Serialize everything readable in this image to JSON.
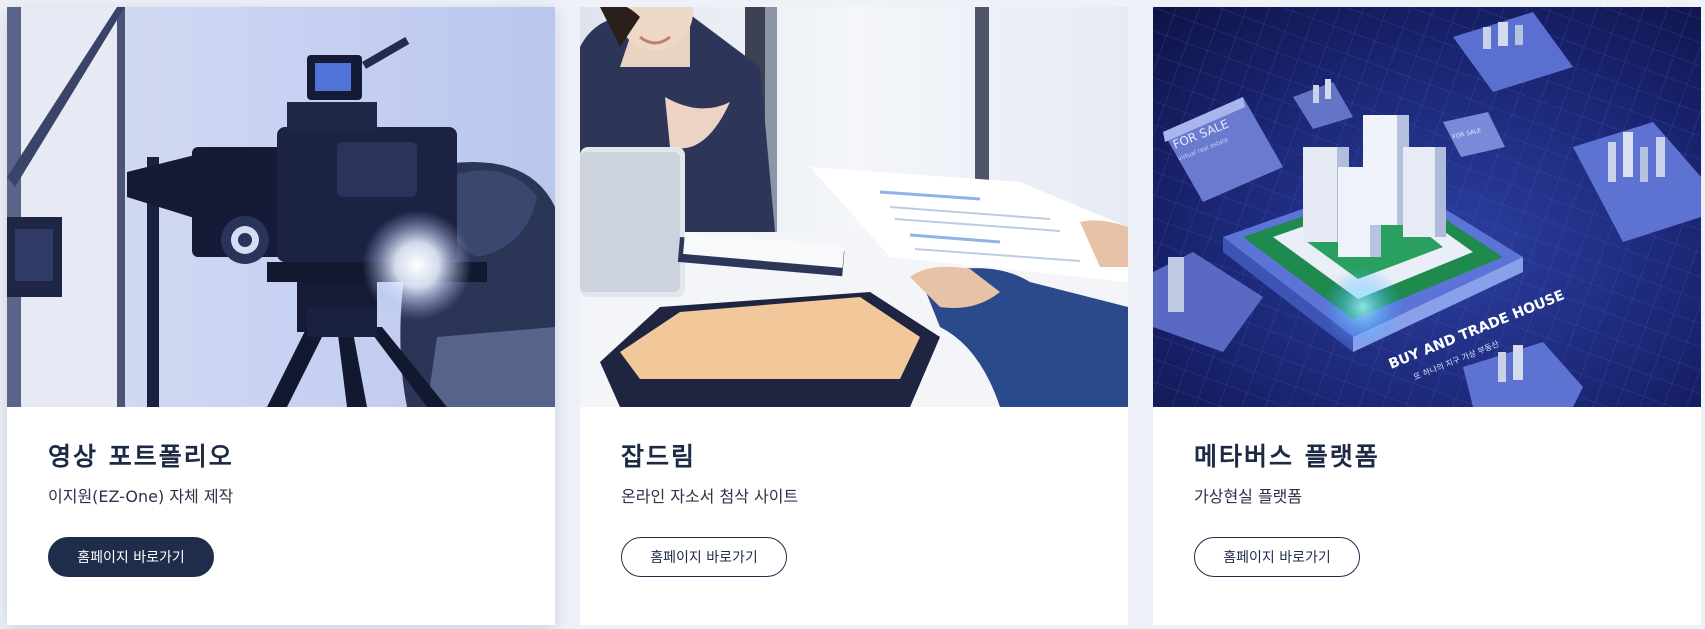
{
  "cards": [
    {
      "title": "영상 포트폴리오",
      "description": "이지원(EZ-One) 자체 제작",
      "button_label": "홈페이지 바로가기",
      "image": "film-camera-photo",
      "active": true
    },
    {
      "title": "잡드림",
      "description": "온라인 자소서 첨삭 사이트",
      "button_label": "홈페이지 바로가기",
      "image": "resume-interview-photo",
      "active": false
    },
    {
      "title": "메타버스 플랫폼",
      "description": "가상현실 플랫폼",
      "button_label": "홈페이지 바로가기",
      "image": "metaverse-city-illustration",
      "active": false,
      "image_text": {
        "for_sale": "FOR SALE",
        "virtual_real_estate": "virtual real estate",
        "small_for_sale": "FOR SALE",
        "banner_main": "BUY AND TRADE HOUSE",
        "banner_sub": "또 하나의 지구 가상 부동산"
      }
    }
  ],
  "colors": {
    "navy": "#1f2c4a",
    "title": "#1c2a45",
    "background": "#eef1f8",
    "card": "#ffffff"
  }
}
